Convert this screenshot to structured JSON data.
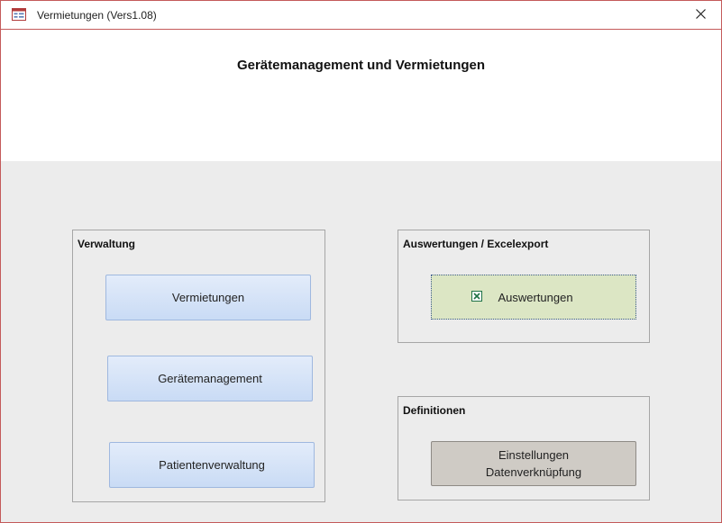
{
  "window": {
    "title": "Vermietungen (Vers1.08)",
    "icons": {
      "app": "form-icon",
      "close": "close-icon"
    }
  },
  "header": {
    "title": "Gerätemanagement und Vermietungen"
  },
  "groups": {
    "verwaltung": {
      "label": "Verwaltung",
      "buttons": [
        "Vermietungen",
        "Gerätemanagement",
        "Patientenverwaltung"
      ]
    },
    "auswertungen": {
      "label": "Auswertungen / Excelexport",
      "button": "Auswertungen",
      "button_icon": "excel-icon"
    },
    "definitionen": {
      "label": "Definitionen",
      "button_line1": "Einstellungen",
      "button_line2": "Datenverknüpfung"
    }
  },
  "colors": {
    "window_border": "#c45a5a",
    "detail_background": "#ececec",
    "button_blue": "#c9dbf5",
    "button_green": "#dce6c4",
    "button_gray": "#cfcbc5",
    "excel_green": "#1e7145"
  }
}
